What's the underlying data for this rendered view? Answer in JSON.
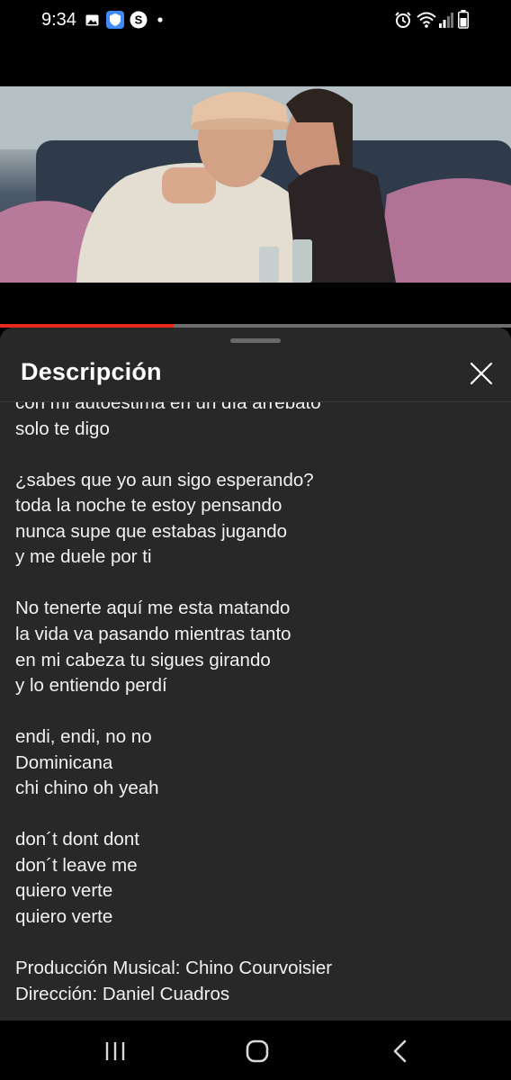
{
  "status_bar": {
    "time": "9:34",
    "left_icons": [
      "gallery-icon",
      "shield-icon",
      "s-app-icon",
      "notification-dot-icon"
    ],
    "right_icons": [
      "alarm-icon",
      "wifi-icon",
      "signal-icon",
      "battery-icon"
    ]
  },
  "video": {
    "progress_fraction": 0.34,
    "colors": {
      "played": "#e52a1f",
      "track": "#6d6d6d"
    }
  },
  "description_panel": {
    "title": "Descripción",
    "close_icon": "close-icon",
    "lines": [
      "con mi autoestima en un día arrebato",
      "solo te digo",
      "",
      "¿sabes que yo aun sigo esperando?",
      "toda la noche te estoy pensando",
      "nunca supe que estabas jugando",
      "y me duele por ti",
      "",
      "No tenerte aquí me esta matando",
      "la vida va pasando mientras tanto",
      "en mi cabeza tu sigues girando",
      "y lo entiendo perdí",
      "",
      "endi, endi, no no",
      "Dominicana",
      "chi chino oh yeah",
      "",
      "don´t dont dont",
      "don´t leave me",
      "quiero verte",
      "quiero verte",
      "",
      "Producción Musical: Chino Courvoisier",
      "Dirección: Daniel Cuadros"
    ]
  },
  "nav_bar": {
    "buttons": [
      "recent-apps-icon",
      "home-icon",
      "back-icon"
    ]
  }
}
